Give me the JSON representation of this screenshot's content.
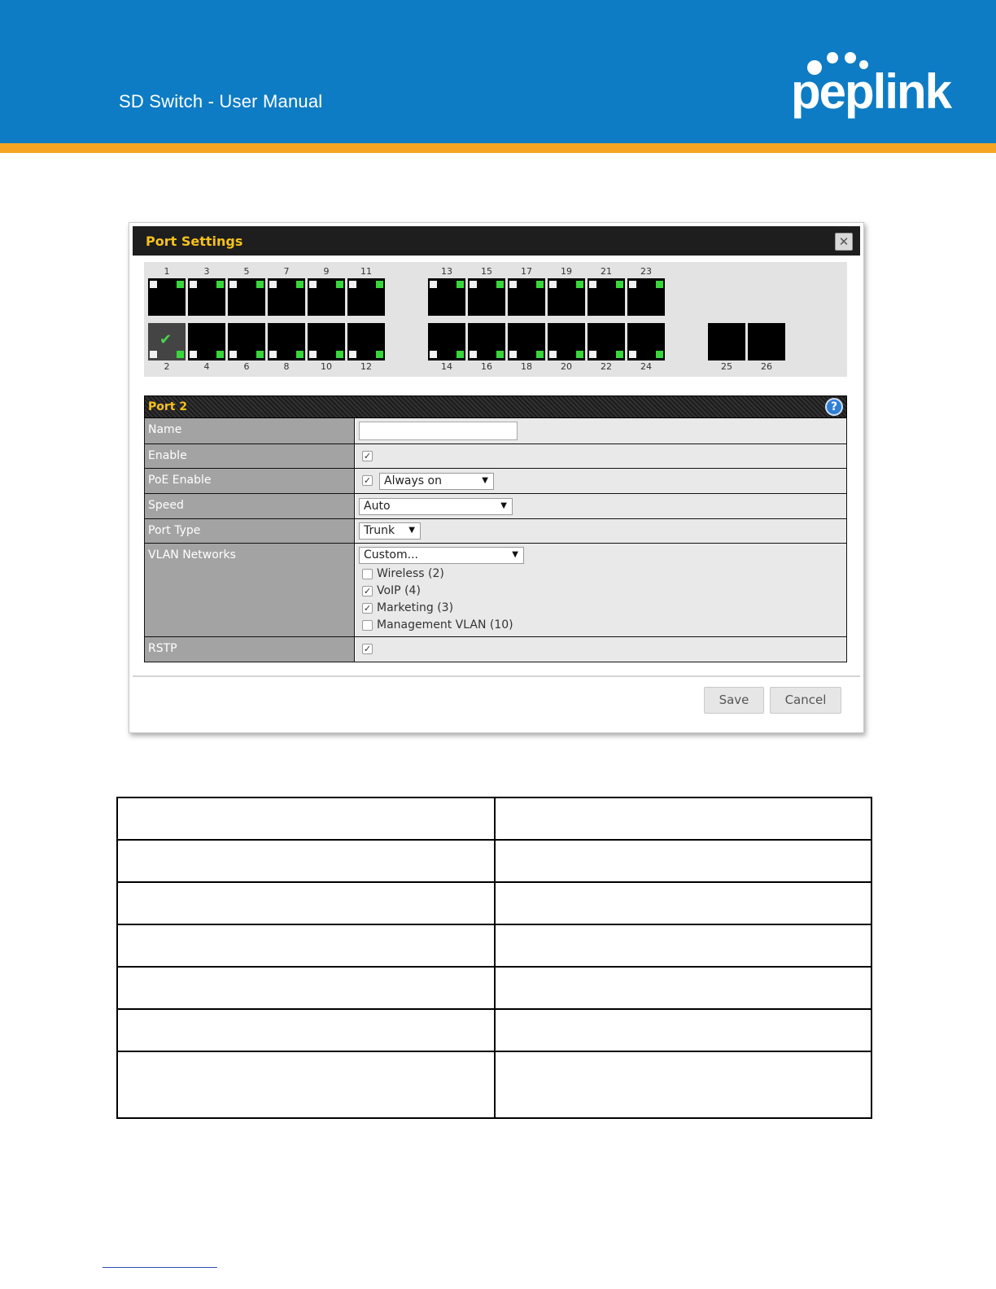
{
  "header": {
    "doc_title": "SD Switch  - User Manual",
    "logo_text": "peplink",
    "banner_color": "#0d7cc4",
    "stripe_color": "#f5a523"
  },
  "dialog": {
    "title": "Port Settings",
    "close_icon": "close-icon",
    "switch": {
      "top_ports": [
        "1",
        "3",
        "5",
        "7",
        "9",
        "11",
        "13",
        "15",
        "17",
        "19",
        "21",
        "23"
      ],
      "bottom_ports": [
        "2",
        "4",
        "6",
        "8",
        "10",
        "12",
        "14",
        "16",
        "18",
        "20",
        "22",
        "24"
      ],
      "sfp_ports": [
        "25",
        "26"
      ],
      "selected_port": "2"
    },
    "form": {
      "title": "Port 2",
      "help_icon": "help-icon",
      "name": {
        "label": "Name",
        "value": ""
      },
      "enable": {
        "label": "Enable",
        "checked": true
      },
      "poe": {
        "label": "PoE Enable",
        "checked": true,
        "mode": "Always on"
      },
      "speed": {
        "label": "Speed",
        "value": "Auto"
      },
      "port_type": {
        "label": "Port Type",
        "value": "Trunk"
      },
      "vlan": {
        "label": "VLAN Networks",
        "value": "Custom...",
        "options": [
          {
            "label": "Wireless (2)",
            "checked": false
          },
          {
            "label": "VoIP (4)",
            "checked": true
          },
          {
            "label": "Marketing (3)",
            "checked": true
          },
          {
            "label": "Management VLAN (10)",
            "checked": false
          }
        ]
      },
      "rstp": {
        "label": "RSTP",
        "checked": true
      }
    },
    "buttons": {
      "save": "Save",
      "cancel": "Cancel"
    }
  },
  "table": {
    "rows": 7,
    "columns": 2
  }
}
